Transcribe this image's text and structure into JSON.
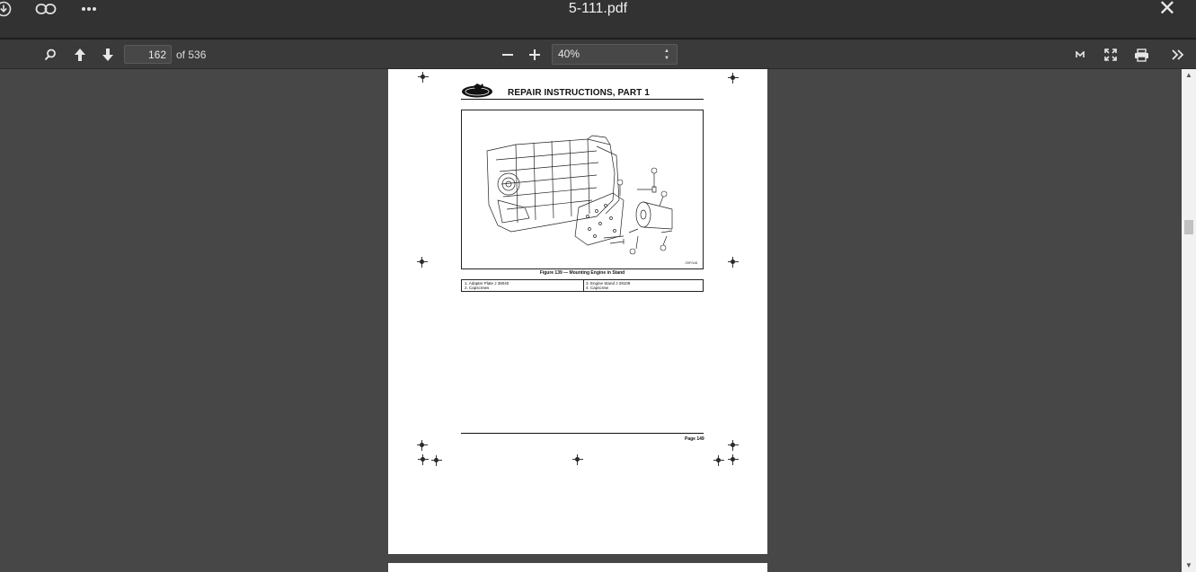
{
  "titlebar": {
    "title": "5-111.pdf",
    "icons": [
      "download-icon",
      "link-icon",
      "more-icon",
      "close-icon"
    ]
  },
  "toolbar": {
    "current_page": "162",
    "page_total": "of 536",
    "zoom": "40%",
    "icons": [
      "search-icon",
      "arrow-up-icon",
      "arrow-down-icon",
      "minus-icon",
      "plus-icon",
      "m-icon",
      "fullscreen-icon",
      "print-icon",
      "double-chevron-icon"
    ]
  },
  "document": {
    "header": "REPAIR INSTRUCTIONS, PART 1",
    "figure_caption": "Figure 139 — Mounting Engine in Stand",
    "figure_code": "25F048",
    "legend": [
      "1. Adapter Plate J 38040",
      "2. Capscrews",
      "3. Engine Stand J 29109",
      "4. Capscrew"
    ],
    "page_label": "Page 149"
  }
}
